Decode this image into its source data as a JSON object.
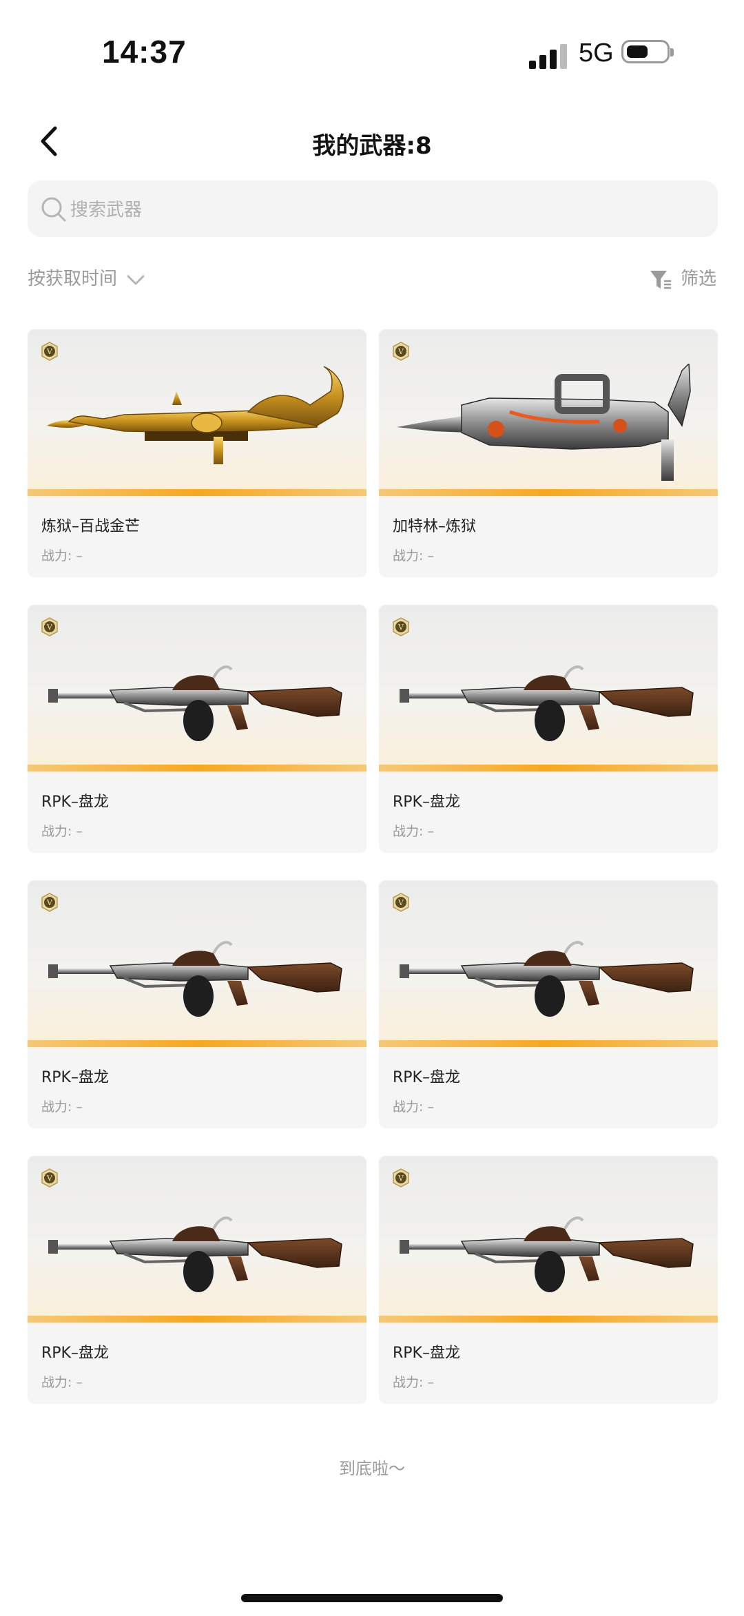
{
  "status": {
    "time": "14:37",
    "network": "5G"
  },
  "header": {
    "title": "我的武器:8"
  },
  "search": {
    "placeholder": "搜索武器"
  },
  "toolbar": {
    "sort_label": "按获取时间",
    "filter_label": "筛选"
  },
  "weapons": [
    {
      "name": "炼狱–百战金芒",
      "power": "战力: –",
      "badge": "V",
      "style": "gold-dragon"
    },
    {
      "name": "加特林–炼狱",
      "power": "战力: –",
      "badge": "V",
      "style": "silver-gatling"
    },
    {
      "name": "RPK–盘龙",
      "power": "战力: –",
      "badge": "V",
      "style": "rpk"
    },
    {
      "name": "RPK–盘龙",
      "power": "战力: –",
      "badge": "V",
      "style": "rpk"
    },
    {
      "name": "RPK–盘龙",
      "power": "战力: –",
      "badge": "V",
      "style": "rpk"
    },
    {
      "name": "RPK–盘龙",
      "power": "战力: –",
      "badge": "V",
      "style": "rpk"
    },
    {
      "name": "RPK–盘龙",
      "power": "战力: –",
      "badge": "V",
      "style": "rpk"
    },
    {
      "name": "RPK–盘龙",
      "power": "战力: –",
      "badge": "V",
      "style": "rpk"
    }
  ],
  "footer": {
    "end_text": "到底啦～"
  },
  "colors": {
    "accent": "#f6a820",
    "card_bg": "#f5f5f5",
    "muted": "#9a9a9a"
  }
}
